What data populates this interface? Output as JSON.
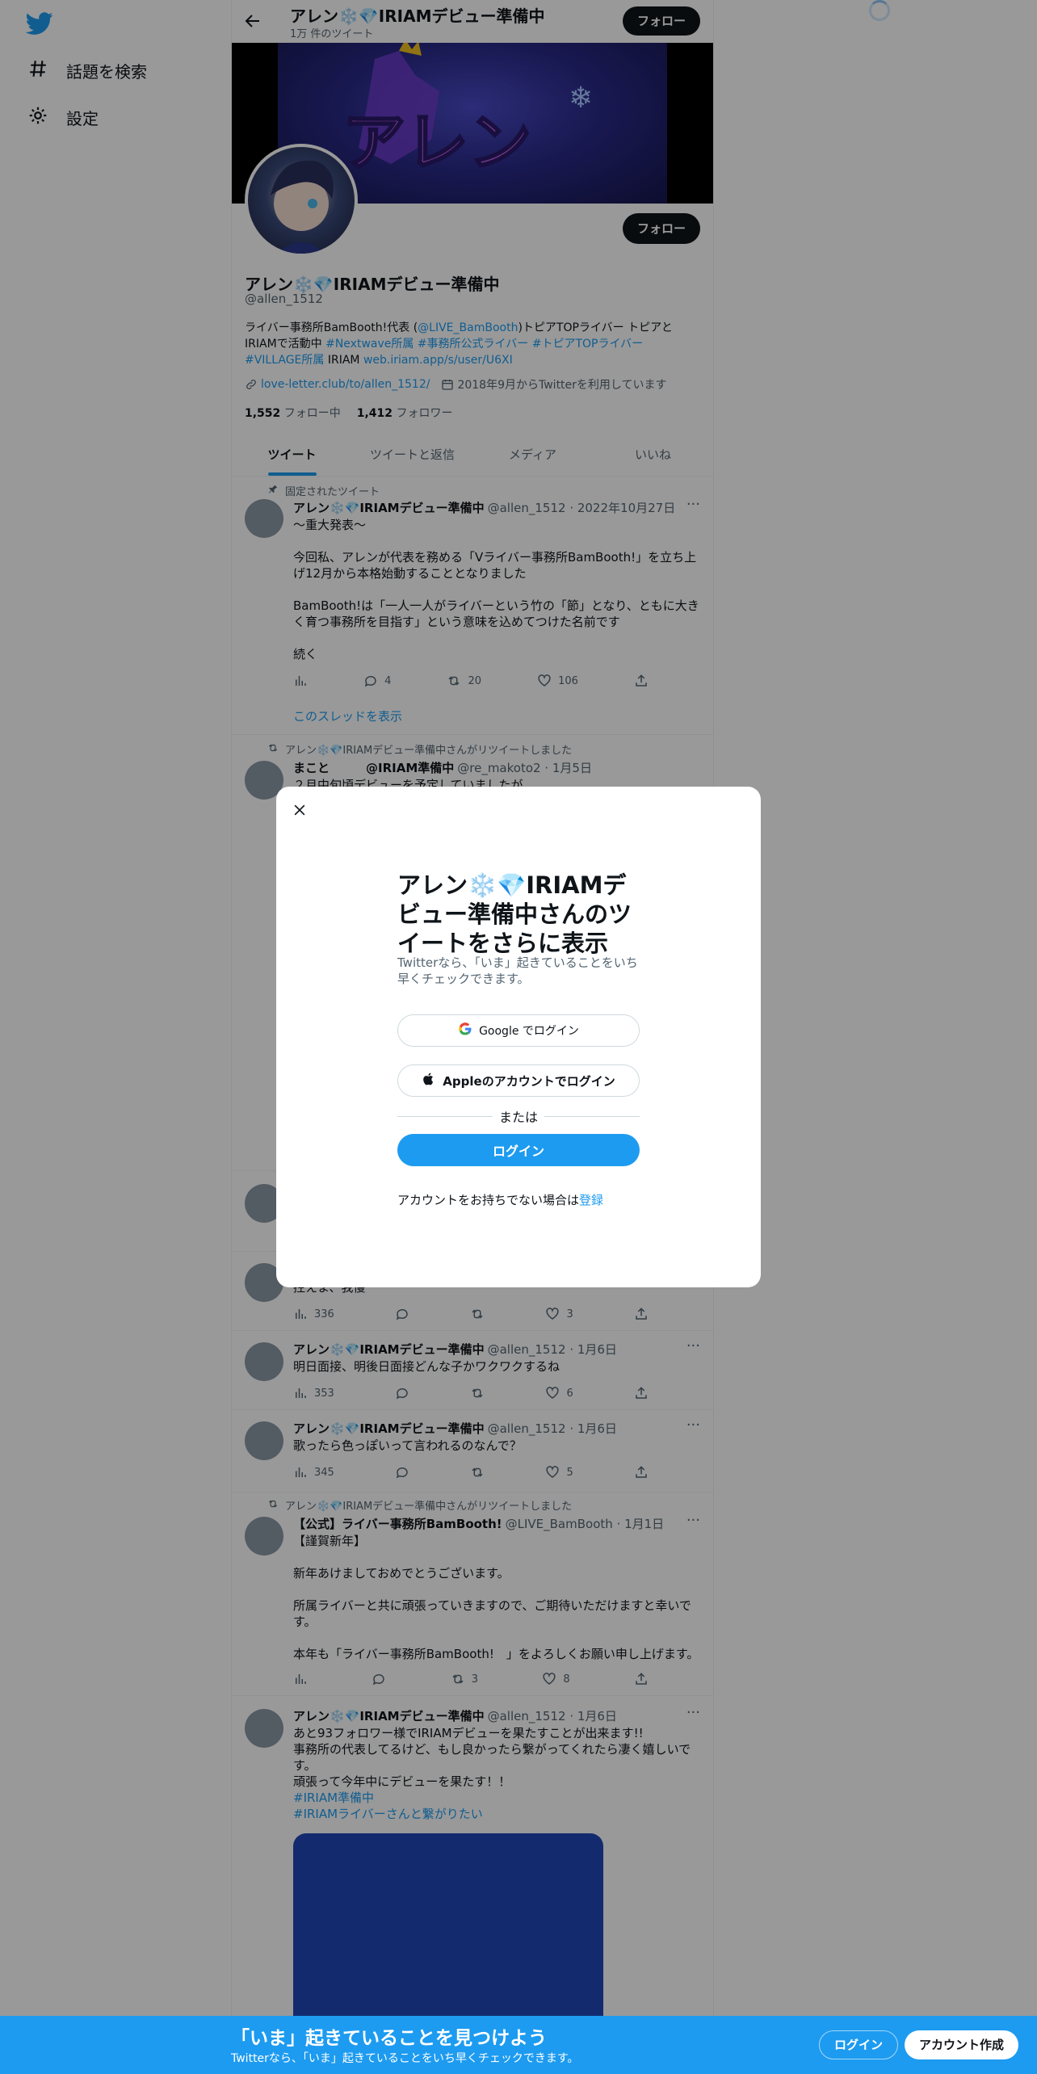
{
  "nav": {
    "explore_label": "話題を検索",
    "settings_label": "設定"
  },
  "topbar": {
    "title": "アレン❄️💎IRIAMデビュー準備中",
    "tweet_count": "1万 件のツイート",
    "follow_label": "フォロー"
  },
  "profile": {
    "follow_label": "フォロー",
    "name": "アレン❄️💎IRIAMデビュー準備中",
    "handle": "@allen_1512",
    "bio_line1_pre": "ライバー事務所BamBooth!代表 (",
    "bio_mention": "@LIVE_BamBooth",
    "bio_line1_post": ")トピアTOPライバー トピアと",
    "bio_line2_pre": "IRIAMで活動中 ",
    "bio_tags_1": "#Nextwave所属 #事務所公式ライバー #トピアTOPライバー",
    "bio_tags_2": "#VILLAGE所属",
    "bio_iriam": " IRIAM ",
    "bio_link": "web.iriam.app/s/user/U6XI",
    "website": "love-letter.club/to/allen_1512/",
    "joined": "2018年9月からTwitterを利用しています",
    "following_count": "1,552",
    "following_label": "フォロー中",
    "followers_count": "1,412",
    "followers_label": "フォロワー"
  },
  "tabs": [
    "ツイート",
    "ツイートと返信",
    "メディア",
    "いいね"
  ],
  "tweets": [
    {
      "context": "固定されたツイート",
      "name": "アレン❄️💎IRIAMデビュー準備中",
      "meta": "@allen_1512 · 2022年10月27日",
      "body": "～重大発表～\n\n今回私、アレンが代表を務める「Vライバー事務所BamBooth!」を立ち上げ12月から本格始動することとなりました\n\nBamBooth!は「一人一人がライバーという竹の「節」となり、ともに大きく育つ事務所を目指す」という意味を込めてつけた名前です\n\n続く",
      "replies": "4",
      "retweets": "20",
      "likes": "106",
      "thread_label": "このスレッドを表示"
    },
    {
      "context": "アレン❄️💎IRIAMデビュー準備中さんがリツイートしました",
      "name": "まこと　　　@IRIAM準備中",
      "meta": "@re_makoto2 · 1月5日",
      "body": "２月中旬頃デビューを予定していましたが"
    },
    {
      "body": "控えま、我慢",
      "views": "336",
      "likes": "3"
    },
    {
      "name": "アレン❄️💎IRIAMデビュー準備中",
      "meta": "@allen_1512 · 1月6日",
      "body": "明日面接、明後日面接どんな子かワクワクするね",
      "views": "353",
      "likes": "6"
    },
    {
      "name": "アレン❄️💎IRIAMデビュー準備中",
      "meta": "@allen_1512 · 1月6日",
      "body": "歌ったら色っぽいって言われるのなんで？",
      "views": "345",
      "likes": "5"
    },
    {
      "context": "アレン❄️💎IRIAMデビュー準備中さんがリツイートしました",
      "name": "【公式】ライバー事務所BamBooth!",
      "meta": "@LIVE_BamBooth · 1月1日",
      "body": "【謹賀新年】\n\n新年あけましておめでとうございます。\n\n所属ライバーと共に頑張っていきますので、ご期待いただけますと幸いです。\n\n本年も「ライバー事務所BamBooth!　」をよろしくお願い申し上げます。",
      "retweets": "3",
      "likes": "8"
    },
    {
      "name": "アレン❄️💎IRIAMデビュー準備中",
      "meta": "@allen_1512 · 1月6日",
      "body": "あと93フォロワー様でIRIAMデビューを果たすことが出来ます!!\n事務所の代表してるけど、もし良かったら繋がってくれたら凄く嬉しいです。\n頑張って今年中にデビューを果たす！！",
      "tag1": "#IRIAM準備中",
      "tag2": "#IRIAMライバーさんと繋がりたい"
    }
  ],
  "modal": {
    "title": "アレン❄️💎IRIAMデビュー準備中さんのツイートをさらに表示",
    "subtitle": "Twitterなら、「いま」起きていることをいち早くチェックできます。",
    "google_label": "Google でログイン",
    "apple_label": "Appleのアカウントでログイン",
    "or_label": "または",
    "login_label": "ログイン",
    "signup_prefix": "アカウントをお持ちでない場合は",
    "signup_link": "登録"
  },
  "bottombar": {
    "title": "「いま」起きていることを見つけよう",
    "subtitle": "Twitterなら、「いま」起きていることをいち早くチェックできます。",
    "login_label": "ログイン",
    "signup_label": "アカウント作成"
  },
  "colors": {
    "accent": "#1d9bf0",
    "text": "#0f1419",
    "secondary": "#536471",
    "border": "#eff3f4"
  }
}
